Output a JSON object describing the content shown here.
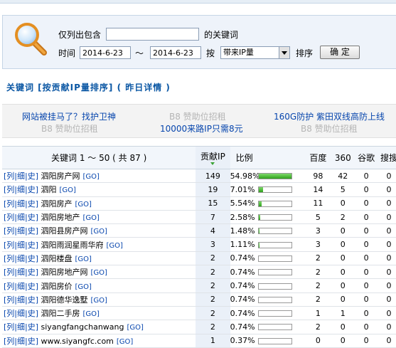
{
  "filter": {
    "label_only_include": "仅列出包含",
    "keyword_value": "",
    "label_keyword_suffix": "的关键词",
    "label_time": "时间",
    "date_from": "2014-6-23",
    "date_sep": "～",
    "date_to": "2014-6-23",
    "label_by": "按",
    "sort_select": "带来IP量",
    "label_sort": "排序",
    "confirm_button": "确 定"
  },
  "section_title": "关键词 [按贡献IP量排序] ( 昨日详情 )",
  "ads": {
    "row1": [
      "网站被挂马了？找护卫神",
      "B8 赞助位招租",
      "160G防护 紫田双线高防上线"
    ],
    "row2": [
      "B8 赞助位招租",
      "10000来路IP只需8元",
      "B8 赞助位招租"
    ]
  },
  "table": {
    "headers": {
      "keyword": "关键词 1 ～ 50 ( 共 87 )",
      "contrib_ip": "贡献IP",
      "ratio": "比例",
      "baidu": "百度",
      "s360": "360",
      "google": "谷歌",
      "sogou": "搜搜"
    },
    "tool_links": [
      "[列",
      "|细",
      "|史]"
    ],
    "go_label": "[GO]",
    "rows": [
      {
        "keyword": "泗阳房产网",
        "ip": "149",
        "ratio": "54.98%",
        "pct": 100,
        "baidu": "98",
        "s360": "42",
        "google": "0",
        "sogou": "0"
      },
      {
        "keyword": "泗阳",
        "ip": "19",
        "ratio": "7.01%",
        "pct": 13,
        "baidu": "14",
        "s360": "5",
        "google": "0",
        "sogou": "0"
      },
      {
        "keyword": "泗阳房产",
        "ip": "15",
        "ratio": "5.54%",
        "pct": 10,
        "baidu": "11",
        "s360": "0",
        "google": "0",
        "sogou": "0"
      },
      {
        "keyword": "泗阳房地产",
        "ip": "7",
        "ratio": "2.58%",
        "pct": 5,
        "baidu": "5",
        "s360": "2",
        "google": "0",
        "sogou": "0"
      },
      {
        "keyword": "泗阳县房产网",
        "ip": "4",
        "ratio": "1.48%",
        "pct": 3,
        "baidu": "3",
        "s360": "0",
        "google": "0",
        "sogou": "0"
      },
      {
        "keyword": "泗阳雨润星雨华府",
        "ip": "3",
        "ratio": "1.11%",
        "pct": 2,
        "baidu": "3",
        "s360": "0",
        "google": "0",
        "sogou": "0"
      },
      {
        "keyword": "泗阳楼盘",
        "ip": "2",
        "ratio": "0.74%",
        "pct": 1,
        "baidu": "2",
        "s360": "0",
        "google": "0",
        "sogou": "0"
      },
      {
        "keyword": "泗阳房地产网",
        "ip": "2",
        "ratio": "0.74%",
        "pct": 1,
        "baidu": "2",
        "s360": "0",
        "google": "0",
        "sogou": "0"
      },
      {
        "keyword": "泗阳房价",
        "ip": "2",
        "ratio": "0.74%",
        "pct": 1,
        "baidu": "2",
        "s360": "0",
        "google": "0",
        "sogou": "0"
      },
      {
        "keyword": "泗阳德华逸墅",
        "ip": "2",
        "ratio": "0.74%",
        "pct": 1,
        "baidu": "2",
        "s360": "0",
        "google": "0",
        "sogou": "0"
      },
      {
        "keyword": "泗阳二手房",
        "ip": "2",
        "ratio": "0.74%",
        "pct": 1,
        "baidu": "1",
        "s360": "1",
        "google": "0",
        "sogou": "0"
      },
      {
        "keyword": "siyangfangchanwang",
        "ip": "2",
        "ratio": "0.74%",
        "pct": 1,
        "baidu": "2",
        "s360": "0",
        "google": "0",
        "sogou": "0"
      },
      {
        "keyword": "www.siyangfc.com",
        "ip": "1",
        "ratio": "0.37%",
        "pct": 1,
        "baidu": "0",
        "s360": "0",
        "google": "0",
        "sogou": "0"
      }
    ]
  }
}
